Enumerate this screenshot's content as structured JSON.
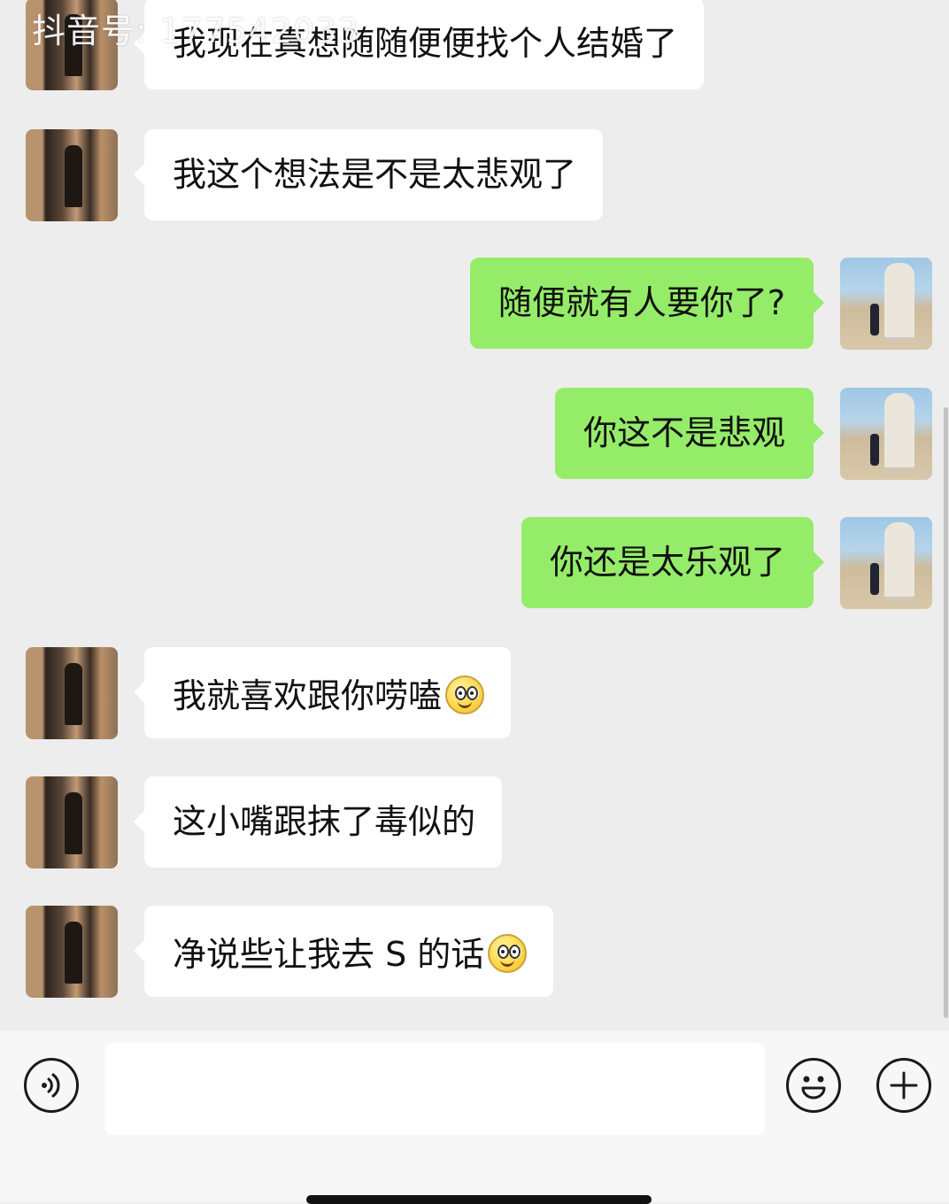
{
  "watermark": "抖音号: 177542033",
  "messages": [
    {
      "side": "left",
      "text": "我现在真想随随便便找个人结婚了",
      "emoji": ""
    },
    {
      "side": "left",
      "text": "我这个想法是不是太悲观了",
      "emoji": ""
    },
    {
      "side": "right",
      "text": "随便就有人要你了?",
      "emoji": ""
    },
    {
      "side": "right",
      "text": "你这不是悲观",
      "emoji": ""
    },
    {
      "side": "right",
      "text": "你还是太乐观了",
      "emoji": ""
    },
    {
      "side": "left",
      "text": "我就喜欢跟你唠嗑",
      "emoji": "smile-emoji"
    },
    {
      "side": "left",
      "text": "这小嘴跟抹了毒似的",
      "emoji": ""
    },
    {
      "side": "left",
      "text": "净说些让我去 S 的话",
      "emoji": "smile-emoji"
    }
  ],
  "input": {
    "value": "",
    "placeholder": ""
  },
  "icons": {
    "voice": "voice-icon",
    "emoji": "emoji-icon",
    "plus": "plus-icon"
  },
  "colors": {
    "background": "#ededed",
    "sent_bubble": "#95ec69",
    "received_bubble": "#ffffff"
  }
}
